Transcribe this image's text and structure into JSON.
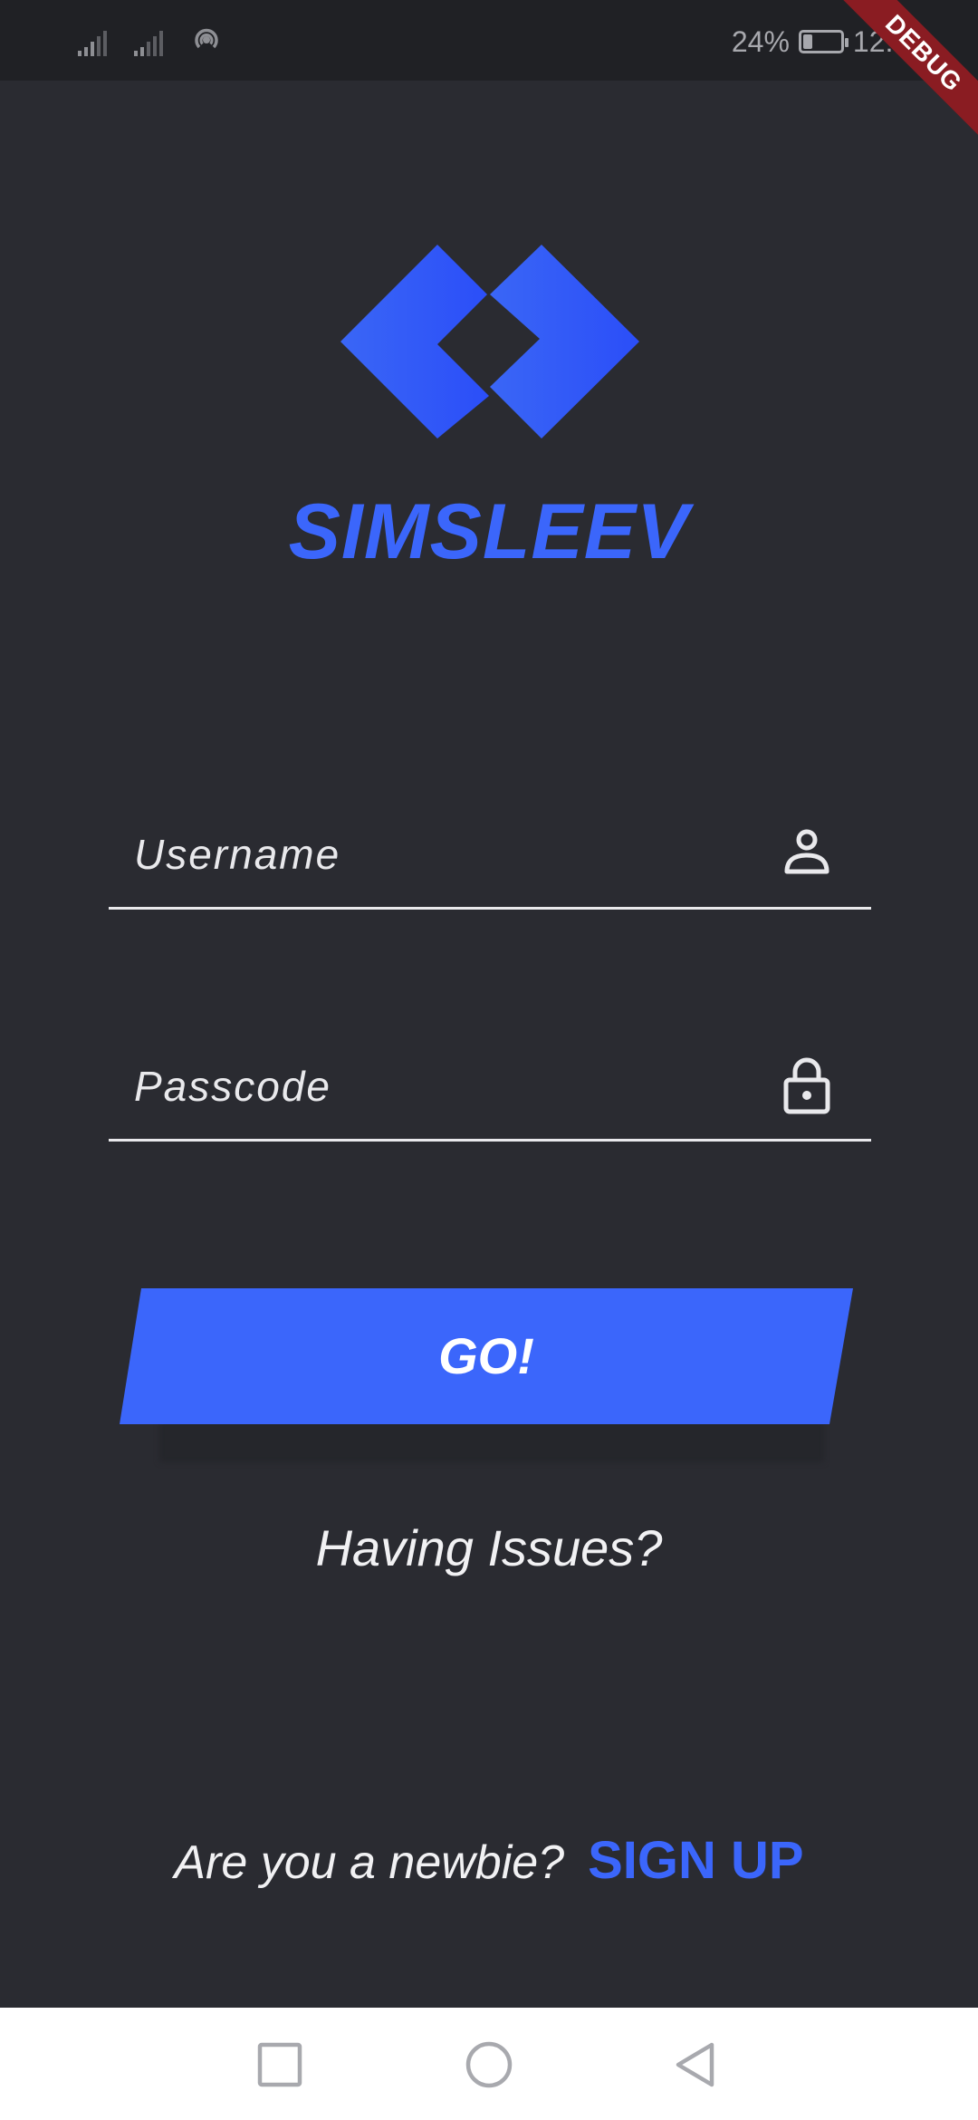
{
  "status_bar": {
    "battery_percent": "24%",
    "battery_level": 0.24,
    "time": "12:44",
    "debug_banner": "DEBUG",
    "icons": [
      "signal-icon",
      "signal-icon",
      "hotspot-icon",
      "battery-icon"
    ]
  },
  "app": {
    "brand_name": "SIMSLEEV",
    "logo_icon": "diamond-logo-icon"
  },
  "login_form": {
    "username_placeholder": "Username",
    "username_icon": "user-icon",
    "passcode_placeholder": "Passcode",
    "passcode_icon": "lock-icon",
    "submit_label": "GO!",
    "help_link": "Having Issues?"
  },
  "signup": {
    "prompt": "Are you a newbie?",
    "link_label": "SIGN UP"
  },
  "nav_bar": {
    "icons": [
      "recents-square-icon",
      "home-circle-icon",
      "back-triangle-icon"
    ]
  },
  "colors": {
    "background": "#2a2b31",
    "status_bar": "#202125",
    "accent": "#3b66fb",
    "text": "#f1f1f3",
    "debug_ribbon": "#8a1c22",
    "nav_bar": "#ffffff"
  }
}
